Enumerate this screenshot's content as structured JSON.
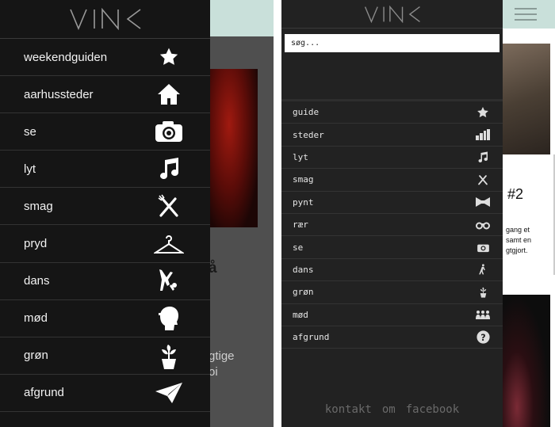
{
  "brand": {
    "logo_text": "VINK"
  },
  "left_menu": {
    "items": [
      {
        "label": "weekendguiden",
        "icon": "star-icon"
      },
      {
        "label": "aarhussteder",
        "icon": "house-icon"
      },
      {
        "label": "se",
        "icon": "camera-icon"
      },
      {
        "label": "lyt",
        "icon": "music-note-icon"
      },
      {
        "label": "smag",
        "icon": "fork-knife-icon"
      },
      {
        "label": "pryd",
        "icon": "hanger-icon"
      },
      {
        "label": "dans",
        "icon": "dancer-icon"
      },
      {
        "label": "mød",
        "icon": "head-cap-icon"
      },
      {
        "label": "grøn",
        "icon": "plant-pot-icon"
      },
      {
        "label": "afgrund",
        "icon": "paper-plane-icon"
      }
    ]
  },
  "left_background": {
    "heading_fragment": "å",
    "text_line_1": "gtige",
    "text_line_2": "oi"
  },
  "right_menu": {
    "search_placeholder": "søg...",
    "items": [
      {
        "label": "guide",
        "icon": "star-icon"
      },
      {
        "label": "steder",
        "icon": "city-icon"
      },
      {
        "label": "lyt",
        "icon": "music-note-icon"
      },
      {
        "label": "smag",
        "icon": "fork-knife-icon"
      },
      {
        "label": "pynt",
        "icon": "bowtie-icon"
      },
      {
        "label": "rær",
        "icon": "binoculars-icon"
      },
      {
        "label": "se",
        "icon": "camera-icon"
      },
      {
        "label": "dans",
        "icon": "dancer-icon"
      },
      {
        "label": "grøn",
        "icon": "plant-pot-icon"
      },
      {
        "label": "mød",
        "icon": "people-icon"
      },
      {
        "label": "afgrund",
        "icon": "question-icon"
      }
    ],
    "footer": {
      "kontakt": "kontakt",
      "om": "om",
      "facebook": "facebook"
    }
  },
  "right_background": {
    "card_number": "#2",
    "card_line_1": "gang et",
    "card_line_2": "samt en",
    "card_line_3": "gtgjort."
  },
  "colors": {
    "drawer_left": "#151515",
    "drawer_right": "#222222",
    "header_mint": "#c9e0da",
    "text_light": "#f2f2f2",
    "footer_link": "#6a6a6a"
  }
}
